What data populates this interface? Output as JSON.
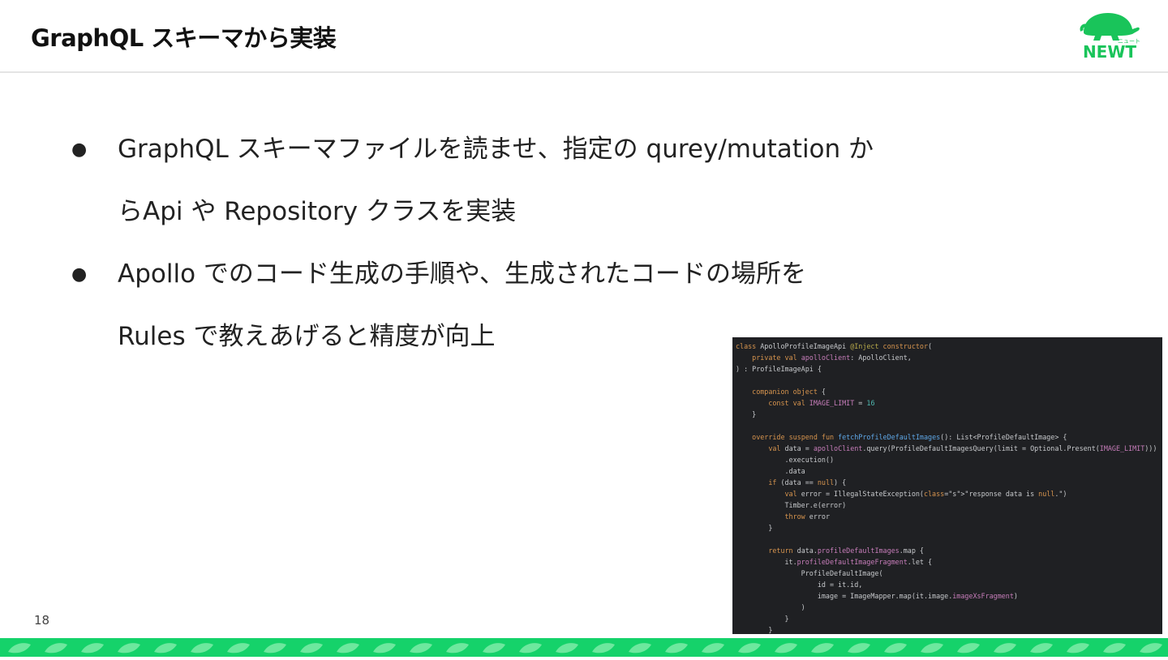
{
  "header": {
    "title": "GraphQL スキーマから実装"
  },
  "logo": {
    "word": "NEWT",
    "kana": "ニュート",
    "color": "#19c45a"
  },
  "bullets": [
    {
      "line1": "GraphQL スキーマファイルを読ませ、指定の qurey/mutation か",
      "line2": "らApi や Repository クラスを実装"
    },
    {
      "line1": "Apollo でのコード生成の手順や、生成されたコードの場所を",
      "line2": "Rules で教えあげると精度が向上"
    }
  ],
  "bullet_symbol": "●",
  "page_number": "18",
  "code_lines": [
    "class ApolloProfileImageApi @Inject constructor(",
    "    private val apolloClient: ApolloClient,",
    ") : ProfileImageApi {",
    "",
    "    companion object {",
    "        const val IMAGE_LIMIT = 16",
    "    }",
    "",
    "    override suspend fun fetchProfileDefaultImages(): List<ProfileDefaultImage> {",
    "        val data = apolloClient.query(ProfileDefaultImagesQuery(limit = Optional.Present(IMAGE_LIMIT)))",
    "            .execution()",
    "            .data",
    "        if (data == null) {",
    "            val error = IllegalStateException(\"response data is null.\")",
    "            Timber.e(error)",
    "            throw error",
    "        }",
    "",
    "        return data.profileDefaultImages.map {",
    "            it.profileDefaultImageFragment.let {",
    "                ProfileDefaultImage(",
    "                    id = it.id,",
    "                    image = ImageMapper.map(it.image.imageXsFragment)",
    "                )",
    "            }",
    "        }"
  ],
  "colors": {
    "accent": "#15d26a",
    "code_bg": "#1f2023"
  }
}
